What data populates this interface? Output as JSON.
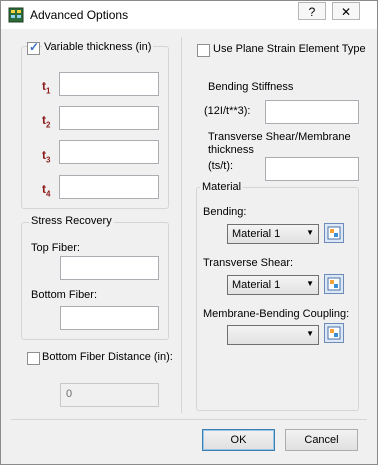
{
  "window": {
    "title": "Advanced Options",
    "help_label": "?",
    "close_label": "✕"
  },
  "thickness": {
    "checkbox_label": "Variable thickness (in)",
    "checked": true,
    "rows": [
      {
        "name": "t",
        "sub": "1",
        "value": ""
      },
      {
        "name": "t",
        "sub": "2",
        "value": ""
      },
      {
        "name": "t",
        "sub": "3",
        "value": ""
      },
      {
        "name": "t",
        "sub": "4",
        "value": ""
      }
    ]
  },
  "stress_recovery": {
    "title": "Stress Recovery",
    "top_fiber_label": "Top Fiber:",
    "top_fiber_value": "",
    "bottom_fiber_label": "Bottom Fiber:",
    "bottom_fiber_value": ""
  },
  "bottom_fiber_distance": {
    "checkbox_label": "Bottom Fiber Distance (in):",
    "checked": false,
    "value": "0"
  },
  "plane_strain": {
    "checkbox_label": "Use Plane Strain Element Type",
    "checked": false
  },
  "bending_stiffness": {
    "label_line1": "Bending Stiffness",
    "label_line2": "(12I/t**3):",
    "value": ""
  },
  "transverse_shear": {
    "label_line1": "Transverse Shear/Membrane",
    "label_line2": "thickness",
    "label_line3": "(ts/t):",
    "value": ""
  },
  "material": {
    "title": "Material",
    "bending_label": "Bending:",
    "bending_value": "Material 1",
    "transverse_label": "Transverse Shear:",
    "transverse_value": "Material 1",
    "coupling_label": "Membrane-Bending Coupling:",
    "coupling_value": ""
  },
  "buttons": {
    "ok": "OK",
    "cancel": "Cancel"
  }
}
